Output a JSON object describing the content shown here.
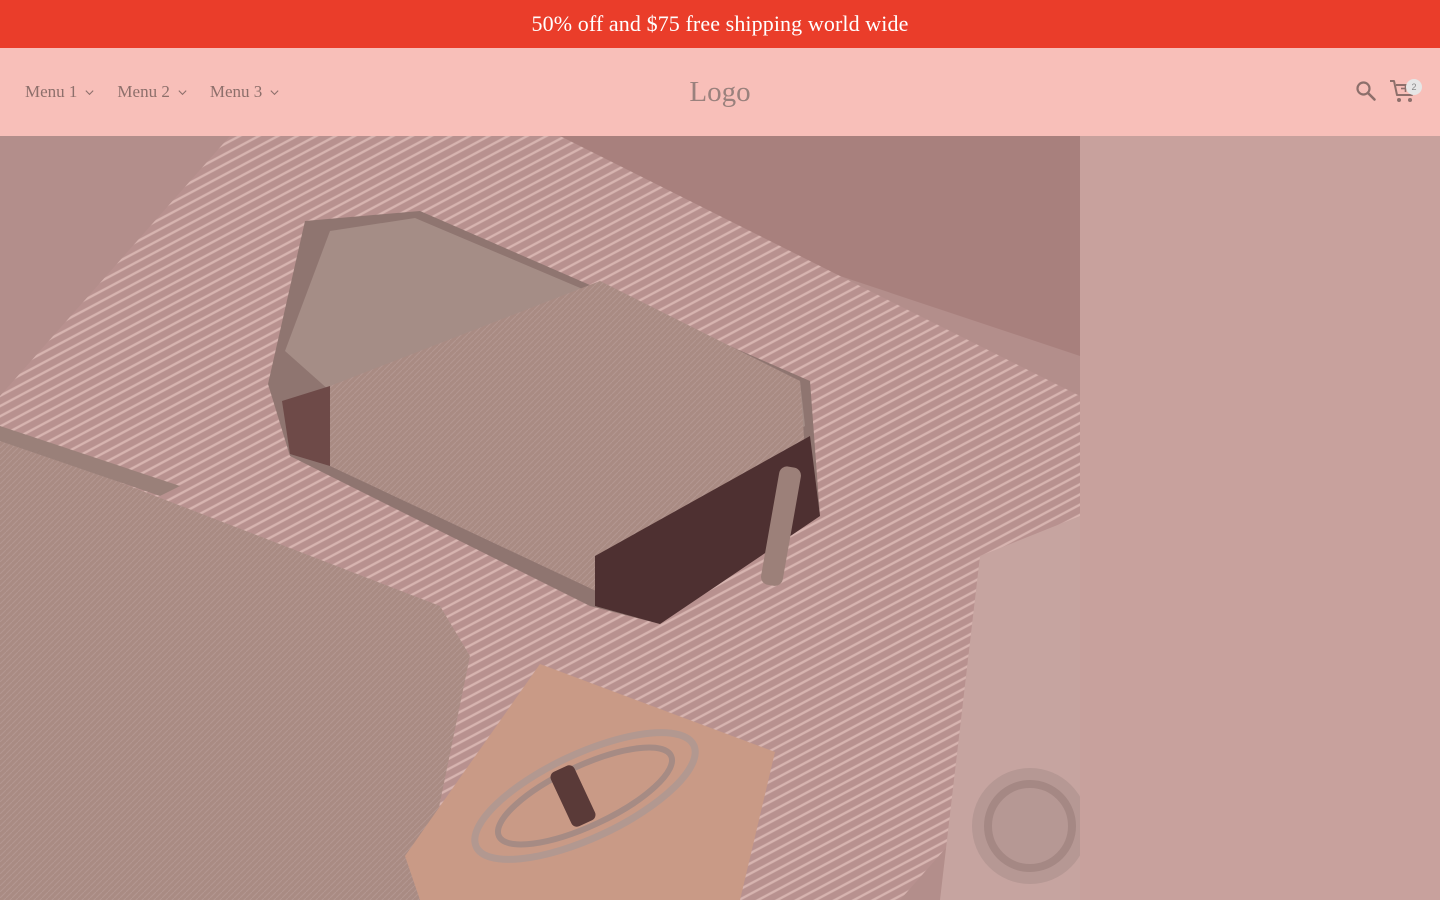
{
  "announcement": {
    "text": "50% off and $75 free shipping world wide"
  },
  "header": {
    "menu": [
      {
        "label": "Menu 1"
      },
      {
        "label": "Menu 2"
      },
      {
        "label": "Menu 3"
      }
    ],
    "logo": "Logo",
    "cart_count": "2"
  },
  "icons": {
    "menu_chevron": "chevron-down-icon",
    "search": "search-icon",
    "cart": "cart-icon"
  },
  "colors": {
    "announcement_bg": "#ea3d2a",
    "header_bg": "#f8bfb9",
    "hero_side_bg": "#c8a19d"
  }
}
